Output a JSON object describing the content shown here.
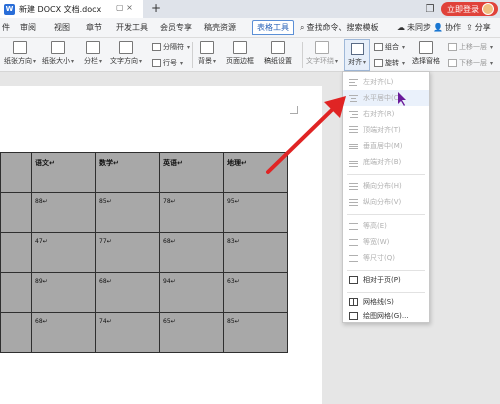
{
  "titlebar": {
    "doc_title": "新建 DOCX 文档.docx",
    "plus": "+",
    "login": "立即登录",
    "minimize": "—"
  },
  "menu": {
    "items": [
      "件",
      "审阅",
      "视图",
      "章节",
      "开发工具",
      "会员专享",
      "稿壳资源",
      "表格工具"
    ],
    "search": "查找命令、搜索模板",
    "sync": "未同步",
    "collab": "协作",
    "share": "分享"
  },
  "ribbon": {
    "paper_direction": "纸张方向",
    "paper_size": "纸张大小",
    "columns": "分栏",
    "text_direction": "文字方向",
    "separator": "分隔符",
    "line_no": "行号",
    "background": "背景",
    "page_border": "页面边框",
    "draft_setting": "稿纸设置",
    "text_wrap": "文字环绕",
    "align": "对齐",
    "group": "组合",
    "rotate": "旋转",
    "select_pane": "选择窗格",
    "bring_forward": "上移一层",
    "send_backward": "下移一层"
  },
  "table": {
    "header": [
      "",
      "语文",
      "数学",
      "英语",
      "地理"
    ],
    "rows": [
      [
        "",
        "88",
        "85",
        "78",
        "95"
      ],
      [
        "",
        "47",
        "77",
        "68",
        "83"
      ],
      [
        "",
        "89",
        "68",
        "94",
        "63"
      ],
      [
        "",
        "68",
        "74",
        "65",
        "85"
      ]
    ],
    "para_mark": "↵"
  },
  "align_menu": {
    "items": [
      {
        "label": "左对齐(L)",
        "enabled": false
      },
      {
        "label": "水平居中(C)",
        "enabled": false
      },
      {
        "label": "右对齐(R)",
        "enabled": false
      },
      {
        "label": "顶端对齐(T)",
        "enabled": false
      },
      {
        "label": "垂直居中(M)",
        "enabled": false
      },
      {
        "label": "底端对齐(B)",
        "enabled": false
      },
      {
        "label": "横向分布(H)",
        "enabled": false
      },
      {
        "label": "纵向分布(V)",
        "enabled": false
      },
      {
        "label": "等高(E)",
        "enabled": false
      },
      {
        "label": "等宽(W)",
        "enabled": false
      },
      {
        "label": "等尺寸(Q)",
        "enabled": false
      },
      {
        "label": "相对于页(P)",
        "enabled": true
      },
      {
        "label": "网格线(S)",
        "enabled": true
      },
      {
        "label": "绘图网格(G)...",
        "enabled": true
      }
    ]
  },
  "colors": {
    "arrow": "#e02424",
    "accent": "#2a63b8",
    "login": "#e0423a"
  }
}
